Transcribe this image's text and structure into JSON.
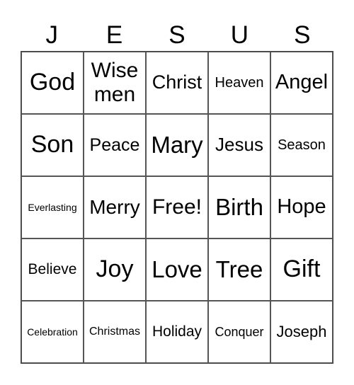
{
  "title_letters": [
    "J",
    "E",
    "S",
    "U",
    "S"
  ],
  "cells": [
    [
      {
        "text": "God",
        "size": 34
      },
      {
        "text": "Wise men",
        "size": 30
      },
      {
        "text": "Christ",
        "size": 27
      },
      {
        "text": "Heaven",
        "size": 20
      },
      {
        "text": "Angel",
        "size": 29
      }
    ],
    [
      {
        "text": "Son",
        "size": 34
      },
      {
        "text": "Peace",
        "size": 25
      },
      {
        "text": "Mary",
        "size": 33
      },
      {
        "text": "Jesus",
        "size": 26
      },
      {
        "text": "Season",
        "size": 20
      }
    ],
    [
      {
        "text": "Everlasting",
        "size": 14
      },
      {
        "text": "Merry",
        "size": 28
      },
      {
        "text": "Free!",
        "size": 30
      },
      {
        "text": "Birth",
        "size": 33
      },
      {
        "text": "Hope",
        "size": 29
      }
    ],
    [
      {
        "text": "Believe",
        "size": 21
      },
      {
        "text": "Joy",
        "size": 34
      },
      {
        "text": "Love",
        "size": 33
      },
      {
        "text": "Tree",
        "size": 33
      },
      {
        "text": "Gift",
        "size": 34
      }
    ],
    [
      {
        "text": "Celebration",
        "size": 14
      },
      {
        "text": "Christmas",
        "size": 16
      },
      {
        "text": "Holiday",
        "size": 21
      },
      {
        "text": "Conquer",
        "size": 18
      },
      {
        "text": "Joseph",
        "size": 22
      }
    ]
  ]
}
